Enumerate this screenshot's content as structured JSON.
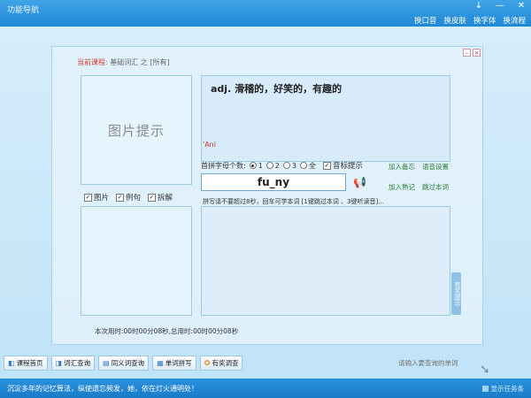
{
  "app": {
    "title": "功能导航"
  },
  "window_controls": [
    "↓",
    "—",
    "✕"
  ],
  "top_menu": [
    "换口音",
    "换皮肤",
    "换字体",
    "换流程"
  ],
  "course": {
    "label": "当前课程:",
    "value": "基础词汇 之 [所有]"
  },
  "image_hint": "图片提示",
  "options": [
    {
      "label": "图片",
      "checked": true
    },
    {
      "label": "例句",
      "checked": true
    },
    {
      "label": "拆解",
      "checked": true
    }
  ],
  "meaning": "adj. 滑稽的，好笑的，有趣的",
  "phonetic": "'Ani",
  "hint_count": {
    "label": "首拼字母个数:",
    "choices": [
      "1",
      "2",
      "3",
      "全"
    ],
    "selected": "1",
    "sound_hint_label": "音标提示",
    "sound_hint_checked": true
  },
  "word_input": "fu_ny",
  "side_links": [
    "加入备忘",
    "语音设置",
    "加入熟记",
    "跳过本词"
  ],
  "spell_tip": "拼写请不要超过8秒，回车可学本词 [1键跳过本词 、3键听读音]...",
  "reward_tab": "有奖提示",
  "time_line": "本次用时:00时00分08秒,总用时:00时00分08秒",
  "toolbar": [
    {
      "icon": "home-icon",
      "glyph": "◧",
      "label": "课程首页"
    },
    {
      "icon": "book-search-icon",
      "glyph": "◨",
      "label": "词汇查询"
    },
    {
      "icon": "synonym-icon",
      "glyph": "▤",
      "label": "同义词查询"
    },
    {
      "icon": "spell-icon",
      "glyph": "▦",
      "label": "单词拼写"
    },
    {
      "icon": "prize-icon",
      "glyph": "✪",
      "label": "有奖调查"
    }
  ],
  "search": {
    "placeholder": "请输入要查询的单词"
  },
  "status": {
    "text": "沉淀多年的记忆算法，纵使遗忘频发，她，依在灯火通明处！",
    "taskbar_label": "显示任务条"
  },
  "colors": {
    "titlebar": "#1f88d6",
    "course_label": "#d23b2b",
    "phonetic": "#c0392b",
    "link_green": "#2e7d32"
  }
}
